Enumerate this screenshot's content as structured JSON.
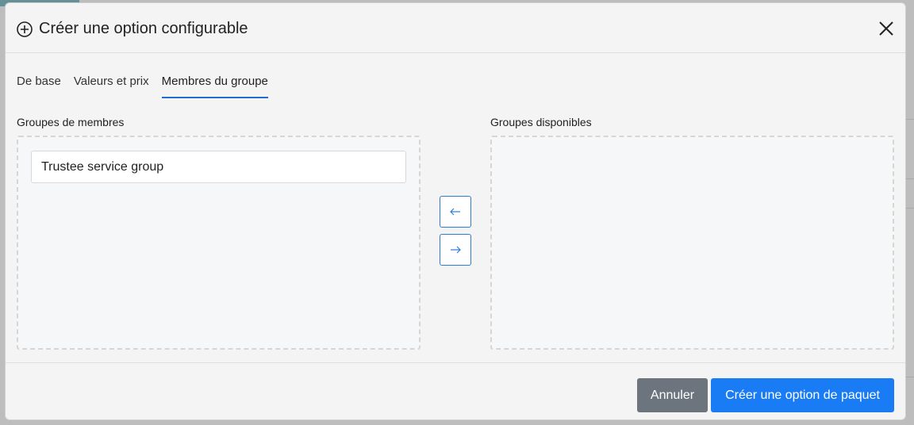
{
  "modal": {
    "title": "Créer une option configurable",
    "title_icon": "plus-circle-icon",
    "close_icon": "close-icon"
  },
  "tabs": [
    {
      "label": "De base",
      "active": false
    },
    {
      "label": "Valeurs et prix",
      "active": false
    },
    {
      "label": "Membres du groupe",
      "active": true
    }
  ],
  "members": {
    "label": "Groupes de membres",
    "items": [
      "Trustee service group"
    ]
  },
  "available": {
    "label": "Groupes disponibles",
    "items": []
  },
  "transfer": {
    "left_icon": "arrow-left-icon",
    "right_icon": "arrow-right-icon"
  },
  "footer": {
    "cancel_label": "Annuler",
    "submit_label": "Créer une option de paquet"
  },
  "colors": {
    "accent": "#1a7cf5",
    "cancel": "#6c757d",
    "tab_underline": "#1f6fd1"
  }
}
